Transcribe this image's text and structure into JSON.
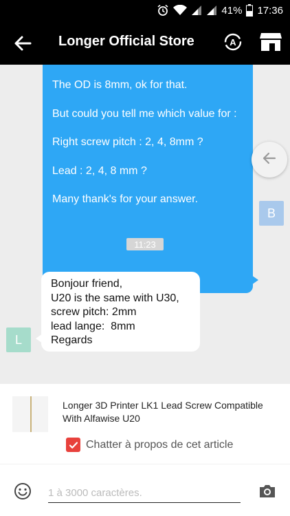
{
  "status_bar": {
    "battery": "41%",
    "time": "17:36"
  },
  "header": {
    "title": "Longer Official Store"
  },
  "messages": {
    "outgoing": {
      "lines": [
        "The OD is 8mm, ok for that.",
        "But could you tell me which value for  :",
        "Right screw pitch : 2, 4, 8mm ?",
        "Lead : 2, 4, 8 mm ?",
        "Many thank's for your answer."
      ],
      "avatar": "B"
    },
    "timestamp": "11:23",
    "incoming": {
      "lines": [
        "Bonjour friend,",
        "U20 is the same with U30,",
        "screw pitch: 2mm",
        "lead lange:  8mm",
        "Regards"
      ],
      "avatar": "L"
    }
  },
  "product": {
    "title": "Longer 3D Printer LK1 Lead Screw Compatible With Alfawise U20",
    "chat_about_label": "Chatter à propos de cet article",
    "chat_about_checked": true
  },
  "input": {
    "placeholder": "1 à 3000 caractères."
  },
  "colors": {
    "outgoing_bubble": "#2ea7f5",
    "checkbox": "#e8413c",
    "avatar_b": "#a9c9ec",
    "avatar_l": "#a6dccb"
  }
}
